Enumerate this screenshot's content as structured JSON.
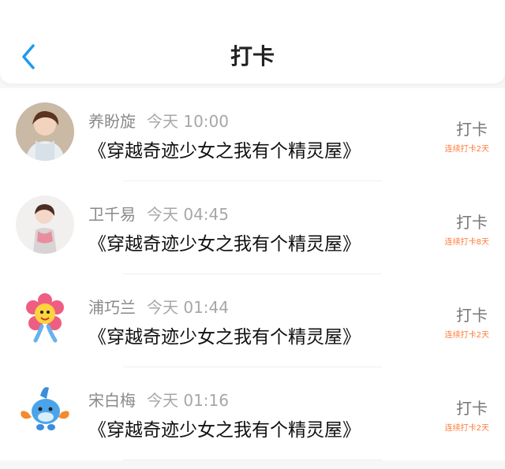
{
  "header": {
    "title": "打卡",
    "back_icon": "chevron-left-icon",
    "accent_color": "#1e9bf0"
  },
  "items": [
    {
      "name": "养盼旋",
      "time": "今天 10:00",
      "book": "《穿越奇迹少女之我有个精灵屋》",
      "checkin_label": "打卡",
      "streak": "连续打卡2天",
      "avatar": "person-photo"
    },
    {
      "name": "卫千易",
      "time": "今天 04:45",
      "book": "《穿越奇迹少女之我有个精灵屋》",
      "checkin_label": "打卡",
      "streak": "连续打卡8天",
      "avatar": "person-photo"
    },
    {
      "name": "浦巧兰",
      "time": "今天 01:44",
      "book": "《穿越奇迹少女之我有个精灵屋》",
      "checkin_label": "打卡",
      "streak": "连续打卡2天",
      "avatar": "flower-mascot"
    },
    {
      "name": "宋白梅",
      "time": "今天 01:16",
      "book": "《穿越奇迹少女之我有个精灵屋》",
      "checkin_label": "打卡",
      "streak": "连续打卡2天",
      "avatar": "mudkip-character"
    }
  ]
}
